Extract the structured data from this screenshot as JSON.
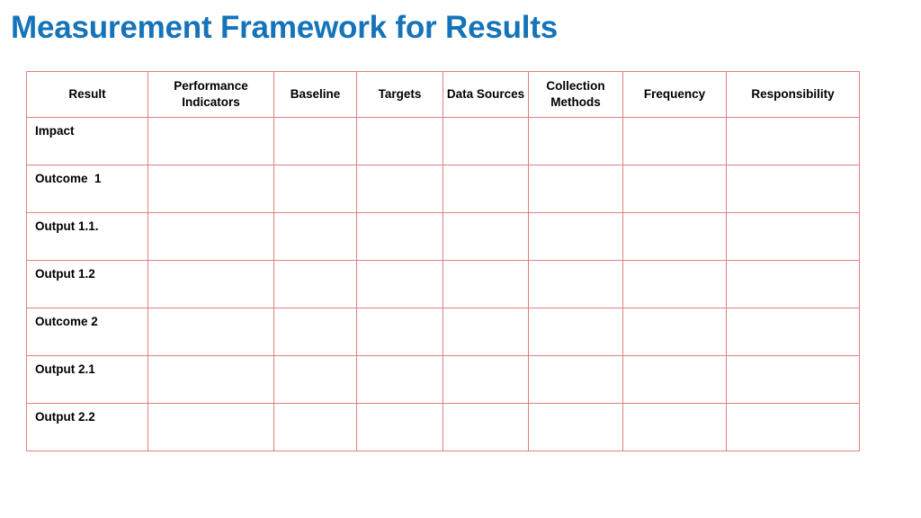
{
  "slide": {
    "title": "Measurement Framework for Results",
    "title_color": "#1573b9",
    "background_color": "#ffffff"
  },
  "table": {
    "border_color": "#df8080",
    "cell_background": "#ffffff",
    "columns": [
      {
        "id": "result",
        "label": "Result"
      },
      {
        "id": "indicators",
        "label": "Performance Indicators"
      },
      {
        "id": "baseline",
        "label": "Baseline"
      },
      {
        "id": "targets",
        "label": "Targets"
      },
      {
        "id": "data_sources",
        "label": "Data Sources"
      },
      {
        "id": "collection",
        "label": "Collection Methods"
      },
      {
        "id": "frequency",
        "label": "Frequency"
      },
      {
        "id": "responsibility",
        "label": "Responsibility"
      }
    ],
    "rows": [
      {
        "id": "impact",
        "result": "Impact",
        "indicators": "",
        "baseline": "",
        "targets": "",
        "data_sources": "",
        "collection": "",
        "frequency": "",
        "responsibility": ""
      },
      {
        "id": "outcome1",
        "result": "Outcome  1",
        "indicators": "",
        "baseline": "",
        "targets": "",
        "data_sources": "",
        "collection": "",
        "frequency": "",
        "responsibility": ""
      },
      {
        "id": "output11",
        "result": "Output 1.1.",
        "indicators": "",
        "baseline": "",
        "targets": "",
        "data_sources": "",
        "collection": "",
        "frequency": "",
        "responsibility": ""
      },
      {
        "id": "output12",
        "result": "Output 1.2",
        "indicators": "",
        "baseline": "",
        "targets": "",
        "data_sources": "",
        "collection": "",
        "frequency": "",
        "responsibility": ""
      },
      {
        "id": "outcome2",
        "result": "Outcome 2",
        "indicators": "",
        "baseline": "",
        "targets": "",
        "data_sources": "",
        "collection": "",
        "frequency": "",
        "responsibility": ""
      },
      {
        "id": "output21",
        "result": "Output 2.1",
        "indicators": "",
        "baseline": "",
        "targets": "",
        "data_sources": "",
        "collection": "",
        "frequency": "",
        "responsibility": ""
      },
      {
        "id": "output22",
        "result": "Output 2.2",
        "indicators": "",
        "baseline": "",
        "targets": "",
        "data_sources": "",
        "collection": "",
        "frequency": "",
        "responsibility": ""
      }
    ]
  }
}
